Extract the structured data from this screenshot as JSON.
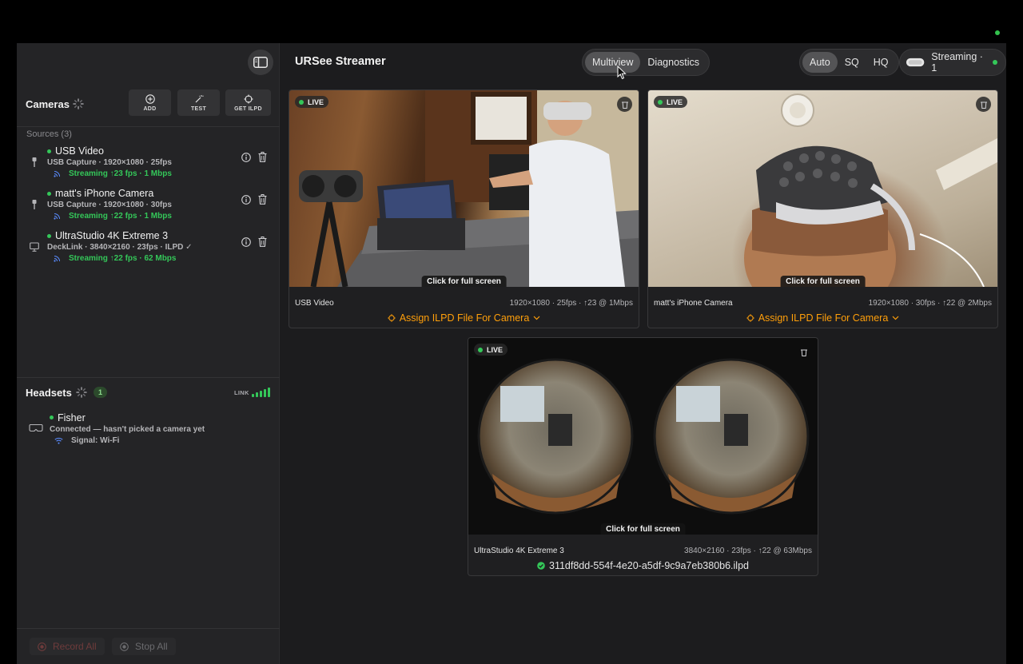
{
  "app": {
    "title": "URSee Streamer"
  },
  "header": {
    "view_tabs": [
      {
        "label": "Multiview",
        "active": true
      },
      {
        "label": "Diagnostics",
        "active": false
      }
    ],
    "quality_tabs": [
      {
        "label": "Auto",
        "active": true
      },
      {
        "label": "SQ",
        "active": false
      },
      {
        "label": "HQ",
        "active": false
      }
    ],
    "streaming_status": "Streaming · 1"
  },
  "cameras_panel": {
    "title": "Cameras",
    "tools": [
      {
        "label": "ADD",
        "icon": "plus-circle-icon"
      },
      {
        "label": "TEST",
        "icon": "magic-wand-icon"
      },
      {
        "label": "GET ILPD",
        "icon": "crosshair-icon"
      }
    ],
    "sources_label": "Sources (3)",
    "sources": [
      {
        "name": "USB Video",
        "detail": "USB Capture · 1920×1080 · 25fps",
        "stream": "Streaming ↑23 fps · 1 Mbps",
        "icon": "usb-plug-icon"
      },
      {
        "name": "matt's iPhone Camera",
        "detail": "USB Capture · 1920×1080 · 30fps",
        "stream": "Streaming ↑22 fps · 1 Mbps",
        "icon": "usb-plug-icon"
      },
      {
        "name": "UltraStudio 4K Extreme 3",
        "detail": "DeckLink · 3840×2160 · 23fps · ILPD ✓",
        "stream": "Streaming ↑22 fps · 62 Mbps",
        "icon": "display-icon"
      }
    ]
  },
  "headsets_panel": {
    "title": "Headsets",
    "count": "1",
    "link_label": "LINK",
    "link_strength": 1.0,
    "headsets": [
      {
        "name": "Fisher",
        "status": "Connected — hasn't picked a camera yet",
        "signal": "Signal: Wi-Fi"
      }
    ]
  },
  "footer": {
    "record_all": "Record All",
    "stop_all": "Stop All"
  },
  "cards": [
    {
      "live": "LIVE",
      "fullscreen": "Click for full screen",
      "name": "USB Video",
      "stats": "1920×1080 · 25fps · ↑23 @ 1Mbps",
      "action": "Assign ILPD File For Camera"
    },
    {
      "live": "LIVE",
      "fullscreen": "Click for full screen",
      "name": "matt's iPhone Camera",
      "stats": "1920×1080 · 30fps · ↑22 @ 2Mbps",
      "action": "Assign ILPD File For Camera"
    },
    {
      "live": "LIVE",
      "fullscreen": "Click for full screen",
      "name": "UltraStudio 4K Extreme 3",
      "stats": "3840×2160 · 23fps · ↑22 @ 63Mbps",
      "file": "311df8dd-554f-4e20-a5df-9c9a7eb380b6.ilpd"
    }
  ],
  "colors": {
    "accent_green": "#34c759",
    "accent_orange": "#ff9f0a",
    "background": "#1c1c1e",
    "sidebar": "#242426"
  }
}
